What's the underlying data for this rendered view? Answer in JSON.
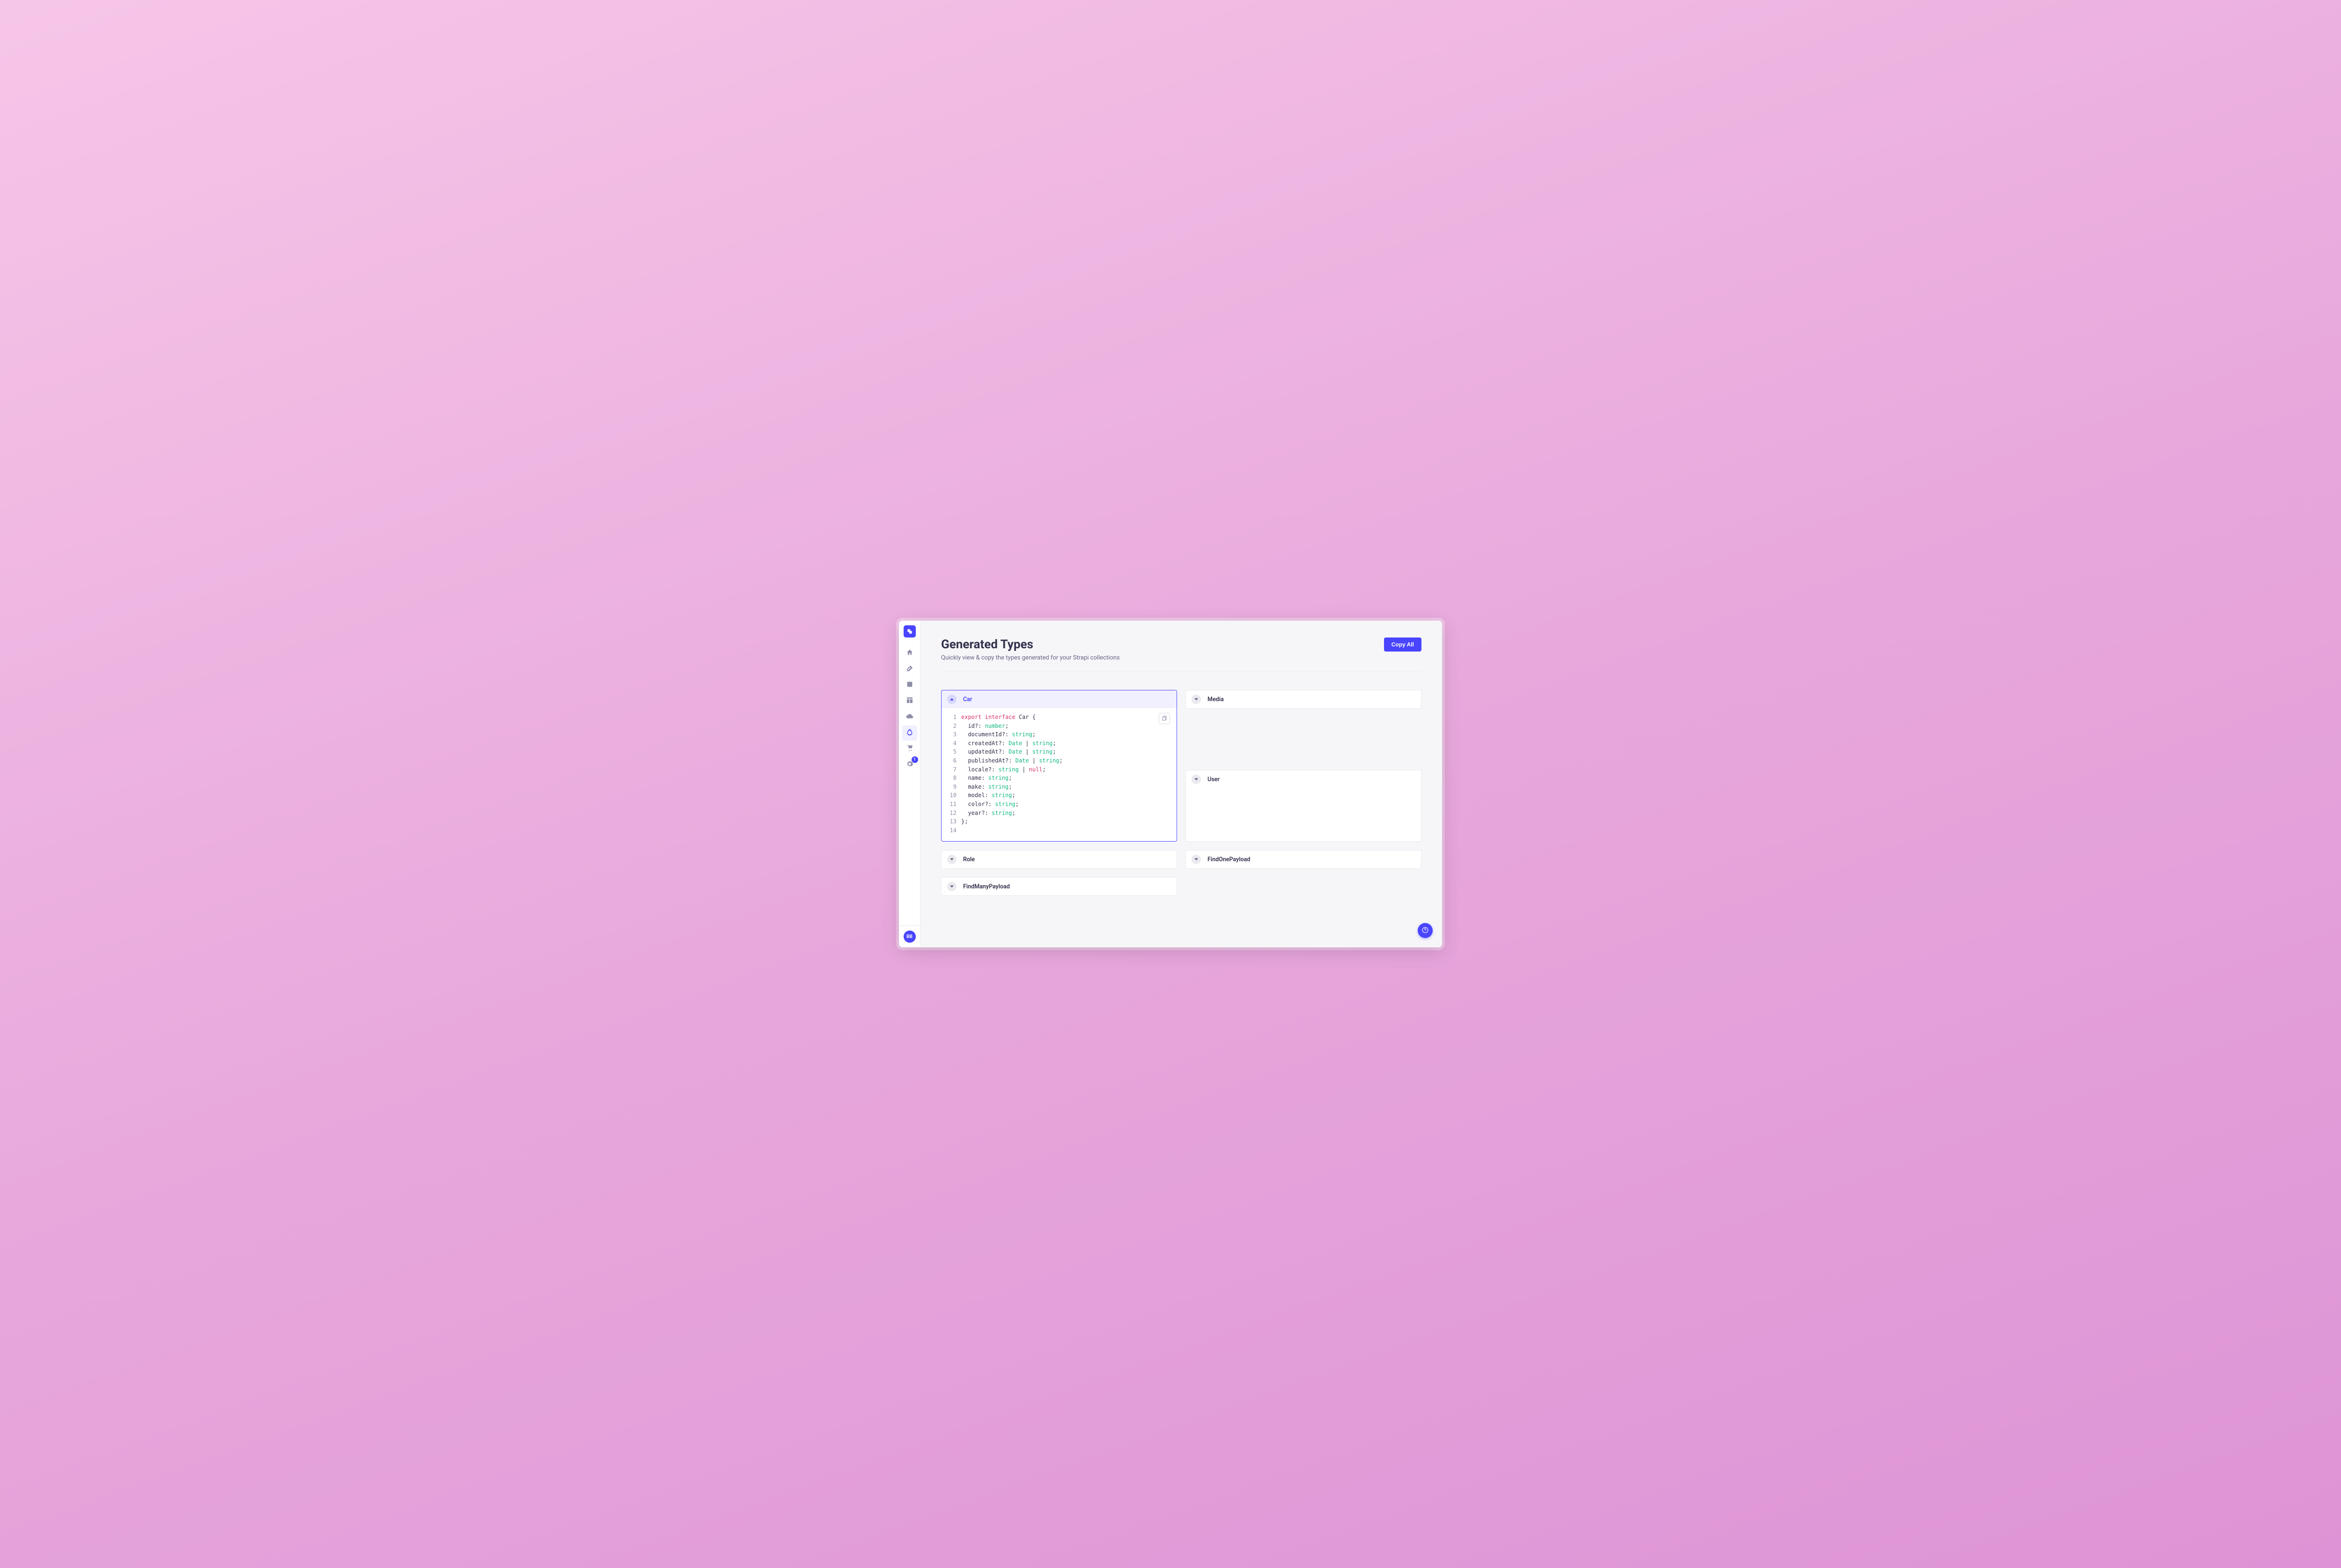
{
  "header": {
    "title": "Generated Types",
    "subtitle": "Quickly view & copy the types generated for your Strapi collections",
    "copy_all_label": "Copy All"
  },
  "sidebar": {
    "settings_badge": "1",
    "avatar_initials": "BB"
  },
  "panels": {
    "car": {
      "title": "Car",
      "expanded": true,
      "code_lines": [
        [
          {
            "t": "export",
            "c": "kw"
          },
          {
            "t": " ",
            "c": ""
          },
          {
            "t": "interface",
            "c": "kw"
          },
          {
            "t": " Car {",
            "c": ""
          }
        ],
        [
          {
            "t": "  id?: ",
            "c": ""
          },
          {
            "t": "number",
            "c": "ty"
          },
          {
            "t": ";",
            "c": ""
          }
        ],
        [
          {
            "t": "  documentId?: ",
            "c": ""
          },
          {
            "t": "string",
            "c": "ty"
          },
          {
            "t": ";",
            "c": ""
          }
        ],
        [
          {
            "t": "  createdAt?: ",
            "c": ""
          },
          {
            "t": "Date",
            "c": "ty"
          },
          {
            "t": " | ",
            "c": ""
          },
          {
            "t": "string",
            "c": "ty"
          },
          {
            "t": ";",
            "c": ""
          }
        ],
        [
          {
            "t": "  updatedAt?: ",
            "c": ""
          },
          {
            "t": "Date",
            "c": "ty"
          },
          {
            "t": " | ",
            "c": ""
          },
          {
            "t": "string",
            "c": "ty"
          },
          {
            "t": ";",
            "c": ""
          }
        ],
        [
          {
            "t": "  publishedAt?: ",
            "c": ""
          },
          {
            "t": "Date",
            "c": "ty"
          },
          {
            "t": " | ",
            "c": ""
          },
          {
            "t": "string",
            "c": "ty"
          },
          {
            "t": ";",
            "c": ""
          }
        ],
        [
          {
            "t": "  locale?: ",
            "c": ""
          },
          {
            "t": "string",
            "c": "ty"
          },
          {
            "t": " | ",
            "c": ""
          },
          {
            "t": "null",
            "c": "nl"
          },
          {
            "t": ";",
            "c": ""
          }
        ],
        [
          {
            "t": "  name: ",
            "c": ""
          },
          {
            "t": "string",
            "c": "ty"
          },
          {
            "t": ";",
            "c": ""
          }
        ],
        [
          {
            "t": "  make: ",
            "c": ""
          },
          {
            "t": "string",
            "c": "ty"
          },
          {
            "t": ";",
            "c": ""
          }
        ],
        [
          {
            "t": "  model: ",
            "c": ""
          },
          {
            "t": "string",
            "c": "ty"
          },
          {
            "t": ";",
            "c": ""
          }
        ],
        [
          {
            "t": "  color?: ",
            "c": ""
          },
          {
            "t": "string",
            "c": "ty"
          },
          {
            "t": ";",
            "c": ""
          }
        ],
        [
          {
            "t": "  year?: ",
            "c": ""
          },
          {
            "t": "string",
            "c": "ty"
          },
          {
            "t": ";",
            "c": ""
          }
        ],
        [
          {
            "t": "};",
            "c": ""
          }
        ],
        [
          {
            "t": "",
            "c": ""
          }
        ]
      ]
    },
    "media": {
      "title": "Media",
      "expanded": false
    },
    "user": {
      "title": "User",
      "expanded": false
    },
    "role": {
      "title": "Role",
      "expanded": false
    },
    "findonepayload": {
      "title": "FindOnePayload",
      "expanded": false
    },
    "findmanypayload": {
      "title": "FindManyPayload",
      "expanded": false
    }
  }
}
